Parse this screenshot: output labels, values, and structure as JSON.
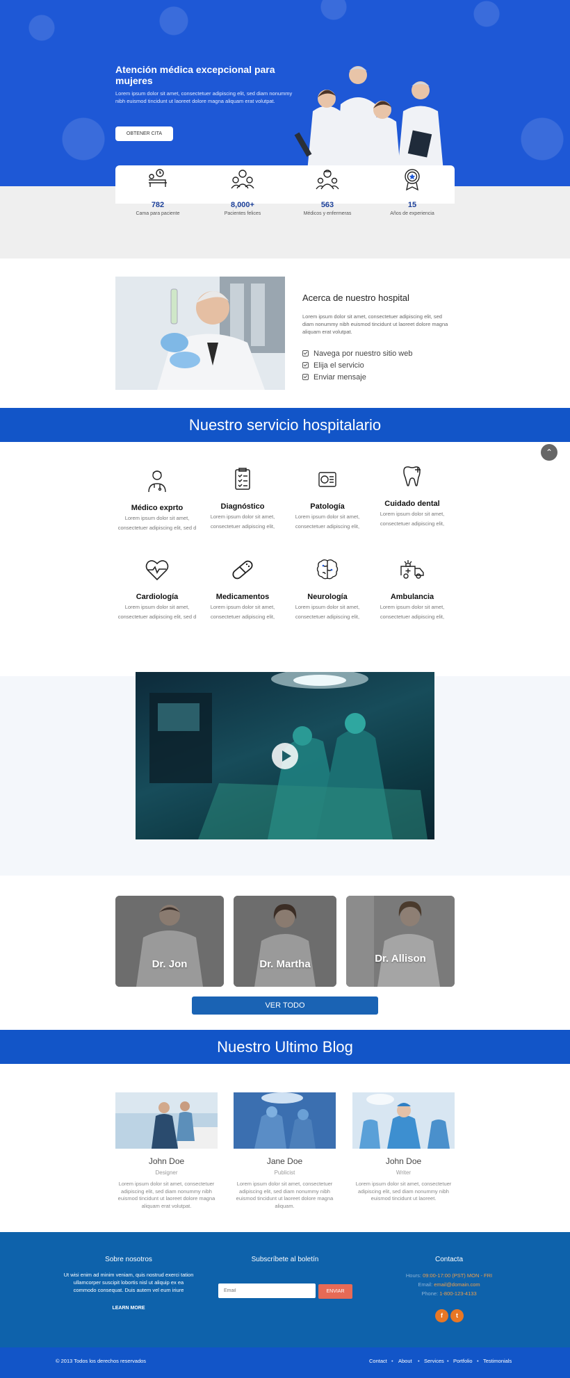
{
  "hero": {
    "title": "Atención médica excepcional para mujeres",
    "text": "Lorem ipsum dolor sit amet, consectetuer adipiscing elit, sed diam nonummy nibh euismod tincidunt ut laoreet dolore magna aliquam erat volutpat.",
    "cta": "OBTENER CITA"
  },
  "stats": [
    {
      "value": "782",
      "label": "Cama para paciente",
      "icon": "hospital-bed-icon"
    },
    {
      "value": "8,000+",
      "label": "Pacientes felices",
      "icon": "happy-patients-icon"
    },
    {
      "value": "563",
      "label": "Médicos y enfermeras",
      "icon": "doctors-icon"
    },
    {
      "value": "15",
      "label": "Años de experiencia",
      "icon": "award-icon"
    }
  ],
  "about": {
    "title": "Acerca de nuestro hospital",
    "text": "Lorem ipsum dolor sit amet, consectetuer adipiscing elit, sed diam nonummy nibh euismod tincidunt ut laoreet dolore magna aliquam erat volutpat.",
    "list": [
      "Navega por nuestro sitio web",
      "Elija el servicio",
      "Enviar mensaje"
    ]
  },
  "services_title": "Nuestro servicio hospitalario",
  "services": [
    {
      "title": "Médico exprto",
      "desc1": "Lorem ipsum dolor sit amet,",
      "desc2": "consectetuer adipiscing elit, sed d",
      "icon": "doctor-icon"
    },
    {
      "title": "Diagnóstico",
      "desc1": "Lorem ipsum dolor sit amet,",
      "desc2": "consectetuer adipiscing elit,",
      "icon": "clipboard-icon"
    },
    {
      "title": "Patología",
      "desc1": "Lorem ipsum dolor sit amet,",
      "desc2": "consectetuer adipiscing elit,",
      "icon": "pathology-icon"
    },
    {
      "title": "Cuidado dental",
      "desc1": "Lorem ipsum dolor sit amet,",
      "desc2": "consectetuer adipiscing elit,",
      "icon": "tooth-icon"
    },
    {
      "title": "Cardiología",
      "desc1": "Lorem ipsum dolor sit amet,",
      "desc2": "consectetuer adipiscing elit, sed d",
      "icon": "heart-icon"
    },
    {
      "title": "Medicamentos",
      "desc1": "Lorem ipsum dolor sit amet,",
      "desc2": "consectetuer adipiscing elit,",
      "icon": "pill-icon"
    },
    {
      "title": "Neurología",
      "desc1": "Lorem ipsum dolor sit amet,",
      "desc2": "consectetuer adipiscing elit,",
      "icon": "brain-icon"
    },
    {
      "title": "Ambulancia",
      "desc1": "Lorem ipsum dolor sit amet,",
      "desc2": "consectetuer adipiscing elit,",
      "icon": "ambulance-icon"
    }
  ],
  "team": [
    {
      "name": "Dr. Jon"
    },
    {
      "name": "Dr. Martha"
    },
    {
      "name": "Dr. Allison"
    }
  ],
  "team_button": "VER TODO",
  "blog_title": "Nuestro Ultimo Blog",
  "blog": [
    {
      "name": "John Doe",
      "role": "Designer",
      "text": "Lorem ipsum dolor sit amet, consectetuer adipiscing elit, sed diam nonummy nibh euismod tincidunt ut laoreet dolore magna aliquam erat volutpat."
    },
    {
      "name": "Jane Doe",
      "role": "Publicist",
      "text": "Lorem ipsum dolor sit amet, consectetuer adipiscing elit, sed diam nonummy nibh euismod tincidunt ut laoreet dolore magna aliquam."
    },
    {
      "name": "John Doe",
      "role": "Writer",
      "text": "Lorem ipsum dolor sit amet, consectetuer adipiscing elit, sed diam nonummy nibh euismod tincidunt ut laoreet."
    }
  ],
  "footer": {
    "about_title": "Sobre nosotros",
    "about_text": "Ut wisi enim ad minim veniam, quis nostrud exerci tation ullamcorper suscipit lobortis nisl ut aliquip ex ea commodo consequat. Duis autem vel eum iriure",
    "learn_more": "LEARN MORE",
    "newsletter_title": "Subscríbete al boletín",
    "email_placeholder": "Email",
    "send": "ENVIAR",
    "contact_title": "Contacta",
    "hours_label": "Hours:",
    "hours_value": "09:00-17:00 (PST) MON - FRI",
    "email_label": "Email:",
    "email_value": "email@domain.com",
    "phone_label": "Phone:",
    "phone_value": "1-800-123-4133",
    "social": [
      {
        "glyph": "f",
        "icon": "facebook-icon"
      },
      {
        "glyph": "t",
        "icon": "twitter-icon"
      }
    ],
    "copyright": "© 2013 Todos los derechos reservados",
    "nav": [
      "Contact",
      "About",
      "Services",
      "Portfolio",
      "Testimonials"
    ]
  },
  "colors": {
    "primary": "#1e58d6",
    "band": "#1255c8",
    "footer": "#0e62ab",
    "accent": "#e66a56",
    "social": "#e87725"
  }
}
